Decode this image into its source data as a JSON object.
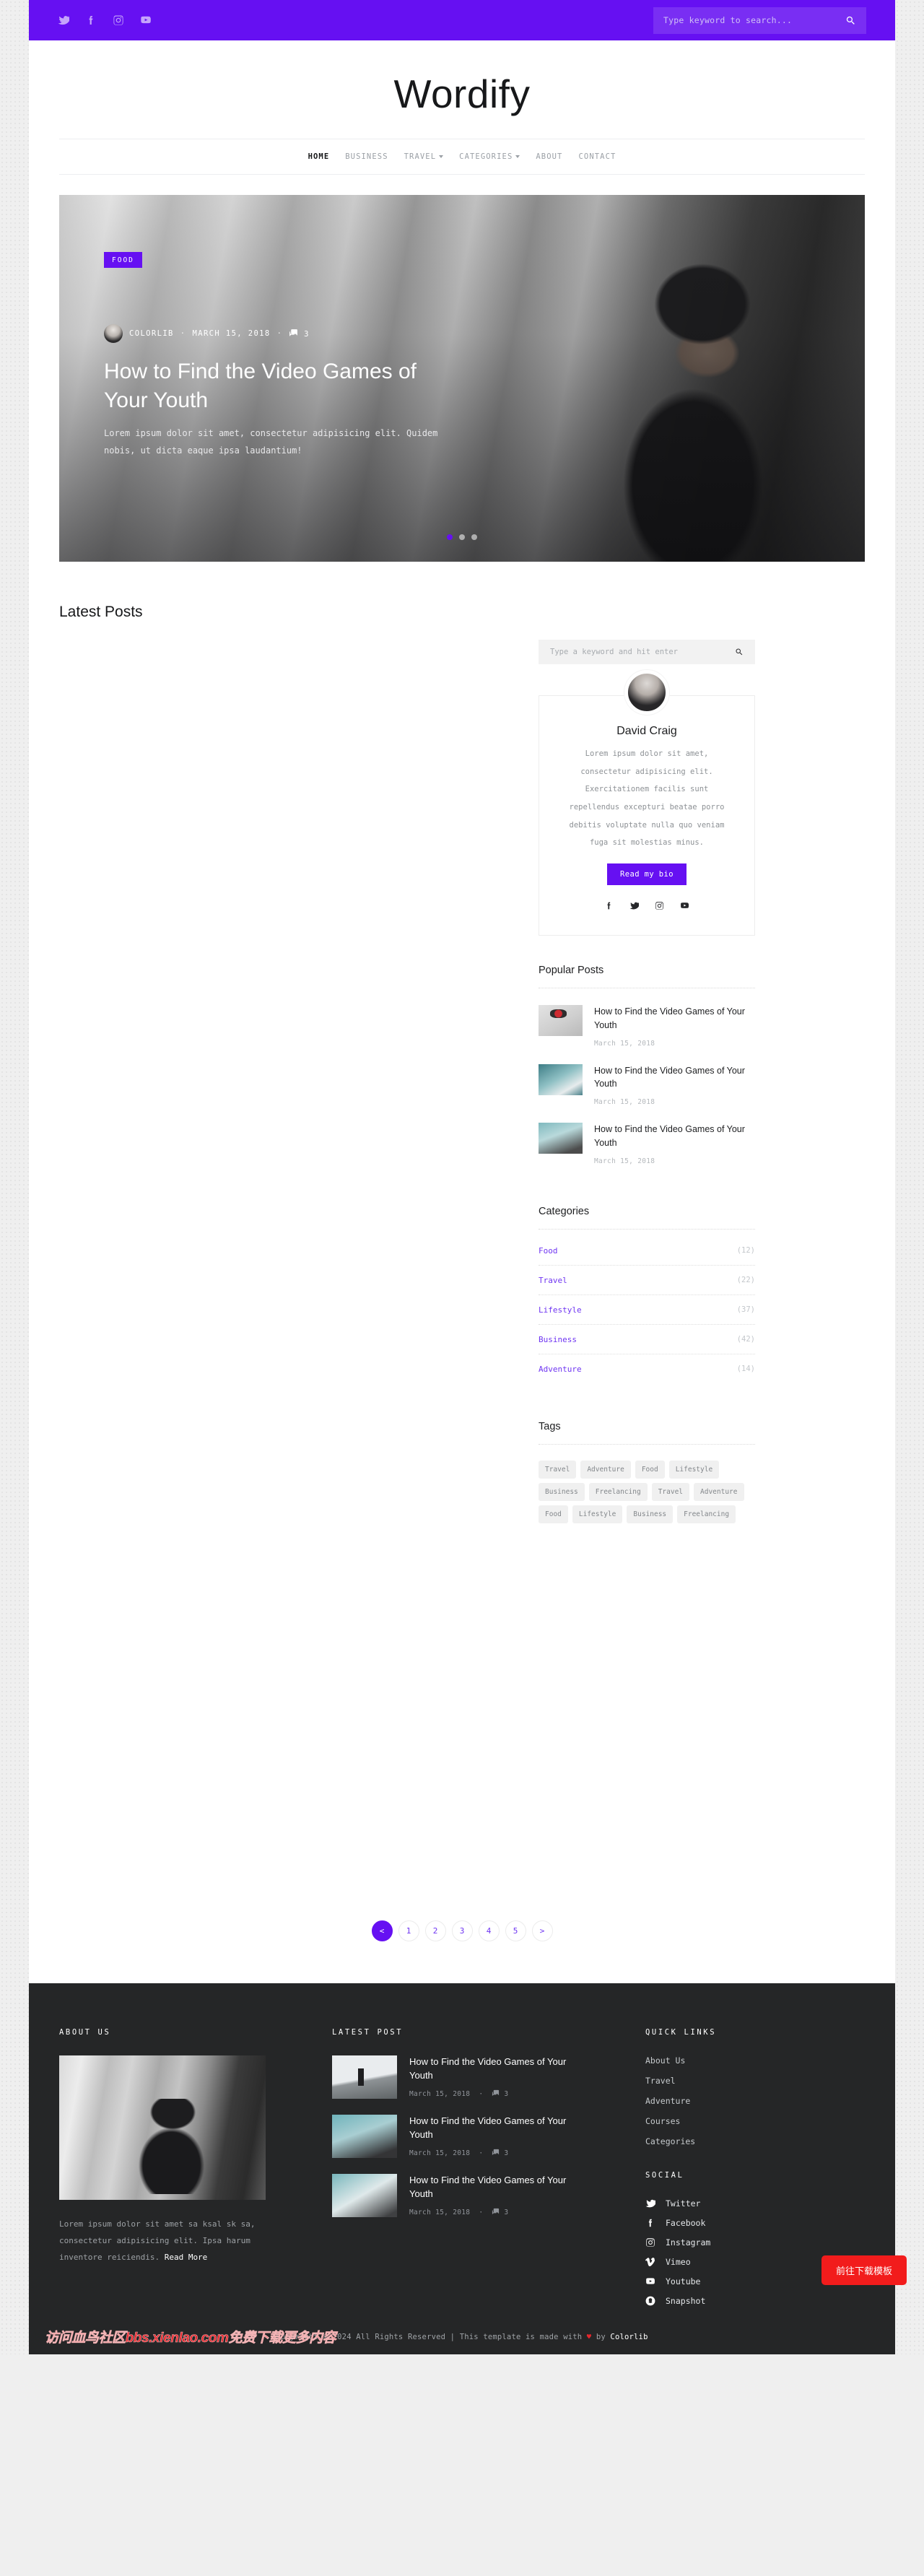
{
  "topbar": {
    "social": [
      {
        "name": "twitter-icon",
        "label": "Twitter"
      },
      {
        "name": "facebook-icon",
        "label": "Facebook"
      },
      {
        "name": "instagram-icon",
        "label": "Instagram"
      },
      {
        "name": "youtube-icon",
        "label": "Youtube"
      }
    ],
    "search_placeholder": "Type keyword to search...",
    "search_value": "",
    "accent_color": "#6610f2"
  },
  "brand": {
    "title": "Wordify"
  },
  "nav": {
    "items": [
      {
        "label": "HOME",
        "active": true,
        "dropdown": false
      },
      {
        "label": "BUSINESS",
        "active": false,
        "dropdown": false
      },
      {
        "label": "TRAVEL",
        "active": false,
        "dropdown": true
      },
      {
        "label": "CATEGORIES",
        "active": false,
        "dropdown": true
      },
      {
        "label": "ABOUT",
        "active": false,
        "dropdown": false
      },
      {
        "label": "CONTACT",
        "active": false,
        "dropdown": false
      }
    ]
  },
  "hero": {
    "badge": "FOOD",
    "author": "COLORLIB",
    "date": "MARCH 15, 2018",
    "comments": "3",
    "title": "How to Find the Video Games of Your Youth",
    "excerpt": "Lorem ipsum dolor sit amet, consectetur adipisicing elit. Quidem nobis, ut dicta eaque ipsa laudantium!",
    "dots": [
      {
        "active": true
      },
      {
        "active": false
      },
      {
        "active": false
      }
    ]
  },
  "main": {
    "section_title": "Latest Posts"
  },
  "sidebar": {
    "search_placeholder": "Type a keyword and hit enter",
    "search_value": "",
    "author": {
      "name": "David Craig",
      "bio": "Lorem ipsum dolor sit amet, consectetur adipisicing elit. Exercitationem facilis sunt repellendus excepturi beatae porro debitis voluptate nulla quo veniam fuga sit molestias minus.",
      "button": "Read my bio",
      "social": [
        {
          "name": "facebook-icon"
        },
        {
          "name": "twitter-icon"
        },
        {
          "name": "instagram-icon"
        },
        {
          "name": "youtube-icon"
        }
      ]
    },
    "popular": {
      "title": "Popular Posts",
      "items": [
        {
          "title": "How to Find the Video Games of Your Youth",
          "date": "March 15, 2018",
          "thumb": "pt1"
        },
        {
          "title": "How to Find the Video Games of Your Youth",
          "date": "March 15, 2018",
          "thumb": "pt2"
        },
        {
          "title": "How to Find the Video Games of Your Youth",
          "date": "March 15, 2018",
          "thumb": "pt3"
        }
      ]
    },
    "categories": {
      "title": "Categories",
      "items": [
        {
          "label": "Food",
          "count": "(12)"
        },
        {
          "label": "Travel",
          "count": "(22)"
        },
        {
          "label": "Lifestyle",
          "count": "(37)"
        },
        {
          "label": "Business",
          "count": "(42)"
        },
        {
          "label": "Adventure",
          "count": "(14)"
        }
      ]
    },
    "tags": {
      "title": "Tags",
      "items": [
        "Travel",
        "Adventure",
        "Food",
        "Lifestyle",
        "Business",
        "Freelancing",
        "Travel",
        "Adventure",
        "Food",
        "Lifestyle",
        "Business",
        "Freelancing"
      ]
    }
  },
  "pagination": {
    "prev": "<",
    "next": ">",
    "pages": [
      "1",
      "2",
      "3",
      "4",
      "5"
    ],
    "active": "<"
  },
  "footer": {
    "about": {
      "title": "ABOUT US",
      "text": "Lorem ipsum dolor sit amet sa ksal sk sa, consectetur adipisicing elit. Ipsa harum inventore reiciendis.",
      "readmore": "Read More"
    },
    "latest": {
      "title": "LATEST POST",
      "items": [
        {
          "title": "How to Find the Video Games of Your Youth",
          "date": "March 15, 2018",
          "comments": "3",
          "thumb": "ft1"
        },
        {
          "title": "How to Find the Video Games of Your Youth",
          "date": "March 15, 2018",
          "comments": "3",
          "thumb": "ft2"
        },
        {
          "title": "How to Find the Video Games of Your Youth",
          "date": "March 15, 2018",
          "comments": "3",
          "thumb": "ft3"
        }
      ]
    },
    "quicklinks": {
      "title": "QUICK LINKS",
      "items": [
        "About Us",
        "Travel",
        "Adventure",
        "Courses",
        "Categories"
      ]
    },
    "social": {
      "title": "SOCIAL",
      "items": [
        {
          "label": "Twitter",
          "icon": "twitter-icon"
        },
        {
          "label": "Facebook",
          "icon": "facebook-icon"
        },
        {
          "label": "Instagram",
          "icon": "instagram-icon"
        },
        {
          "label": "Vimeo",
          "icon": "vimeo-icon"
        },
        {
          "label": "Youtube",
          "icon": "youtube-icon"
        },
        {
          "label": "Snapshot",
          "icon": "snapchat-icon"
        }
      ]
    }
  },
  "bottom": {
    "watermark": "访问血鸟社区bbs.xienlao.com免费下载更多内容",
    "copyright_pre": "Copyright © 2024 All Rights Reserved | This template is made with ",
    "copyright_heart": "♥",
    "copyright_mid": " by ",
    "copyright_brand": "Colorlib"
  },
  "overlay": {
    "download_button": "前往下载模板",
    "download_color": "#f21c1c"
  }
}
